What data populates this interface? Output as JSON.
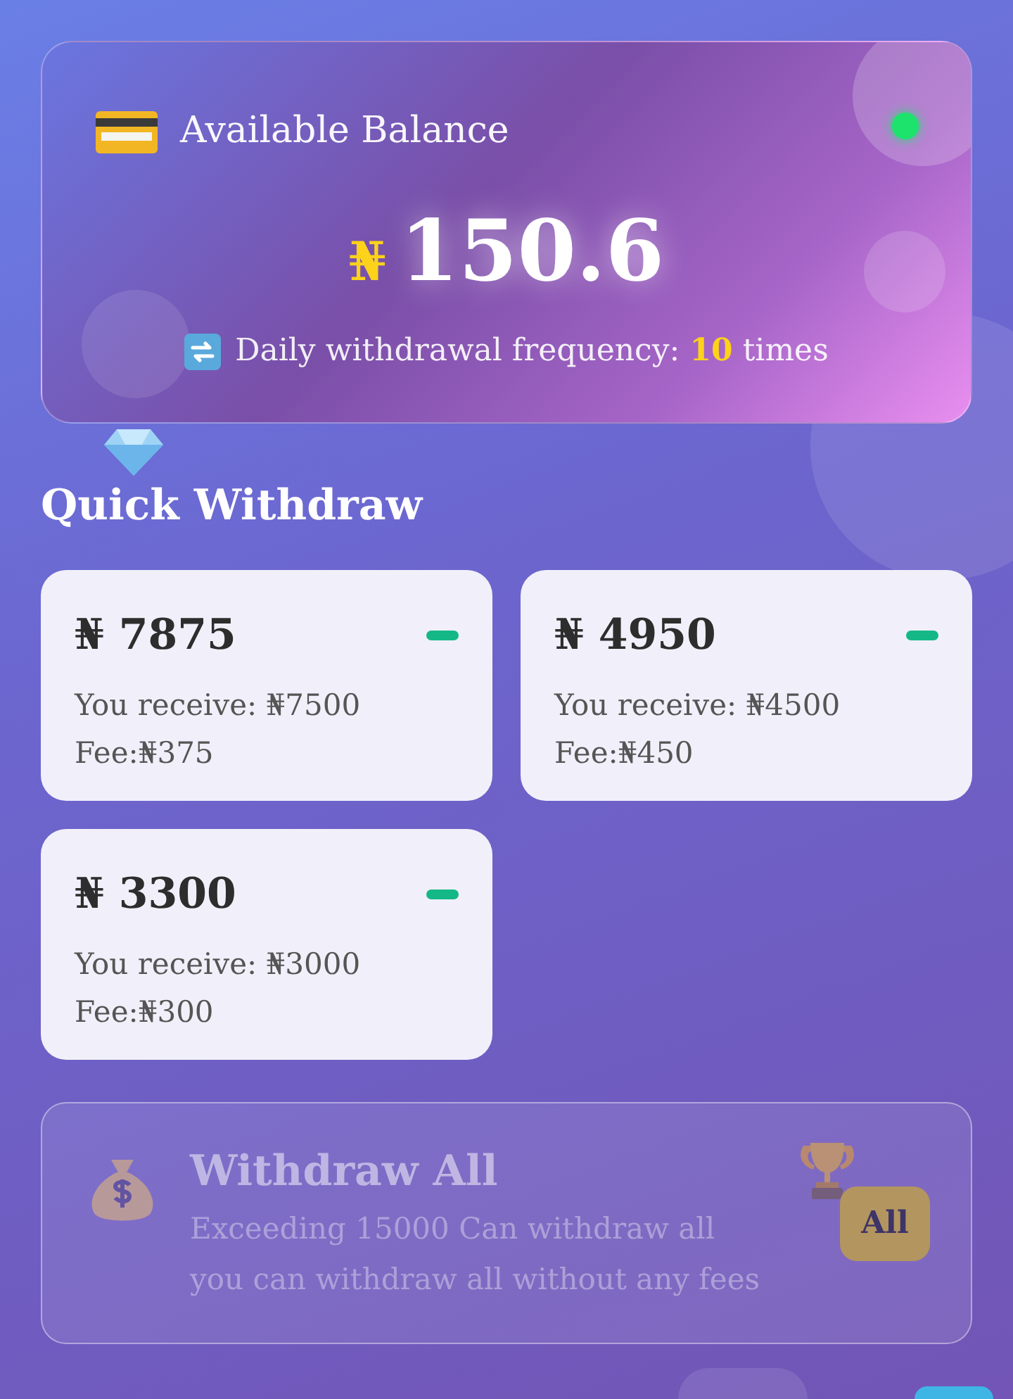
{
  "balance": {
    "label": "Available Balance",
    "currency": "₦",
    "amount": "150.6",
    "frequency_text": "Daily withdrawal frequency:",
    "frequency_count": "10",
    "frequency_unit": "times"
  },
  "quick_withdraw": {
    "title": "Quick Withdraw",
    "options": [
      {
        "amount": "₦ 7875",
        "receive": "You receive: ₦7500",
        "fee": "Fee:₦375"
      },
      {
        "amount": "₦ 4950",
        "receive": "You receive: ₦4500",
        "fee": "Fee:₦450"
      },
      {
        "amount": "₦ 3300",
        "receive": "You receive: ₦3000",
        "fee": "Fee:₦300"
      }
    ]
  },
  "withdraw_all": {
    "title": "Withdraw All",
    "lines": [
      "Exceeding 15000 Can withdraw all",
      "you can withdraw all without any fees"
    ],
    "button": "All",
    "disabled": true
  }
}
